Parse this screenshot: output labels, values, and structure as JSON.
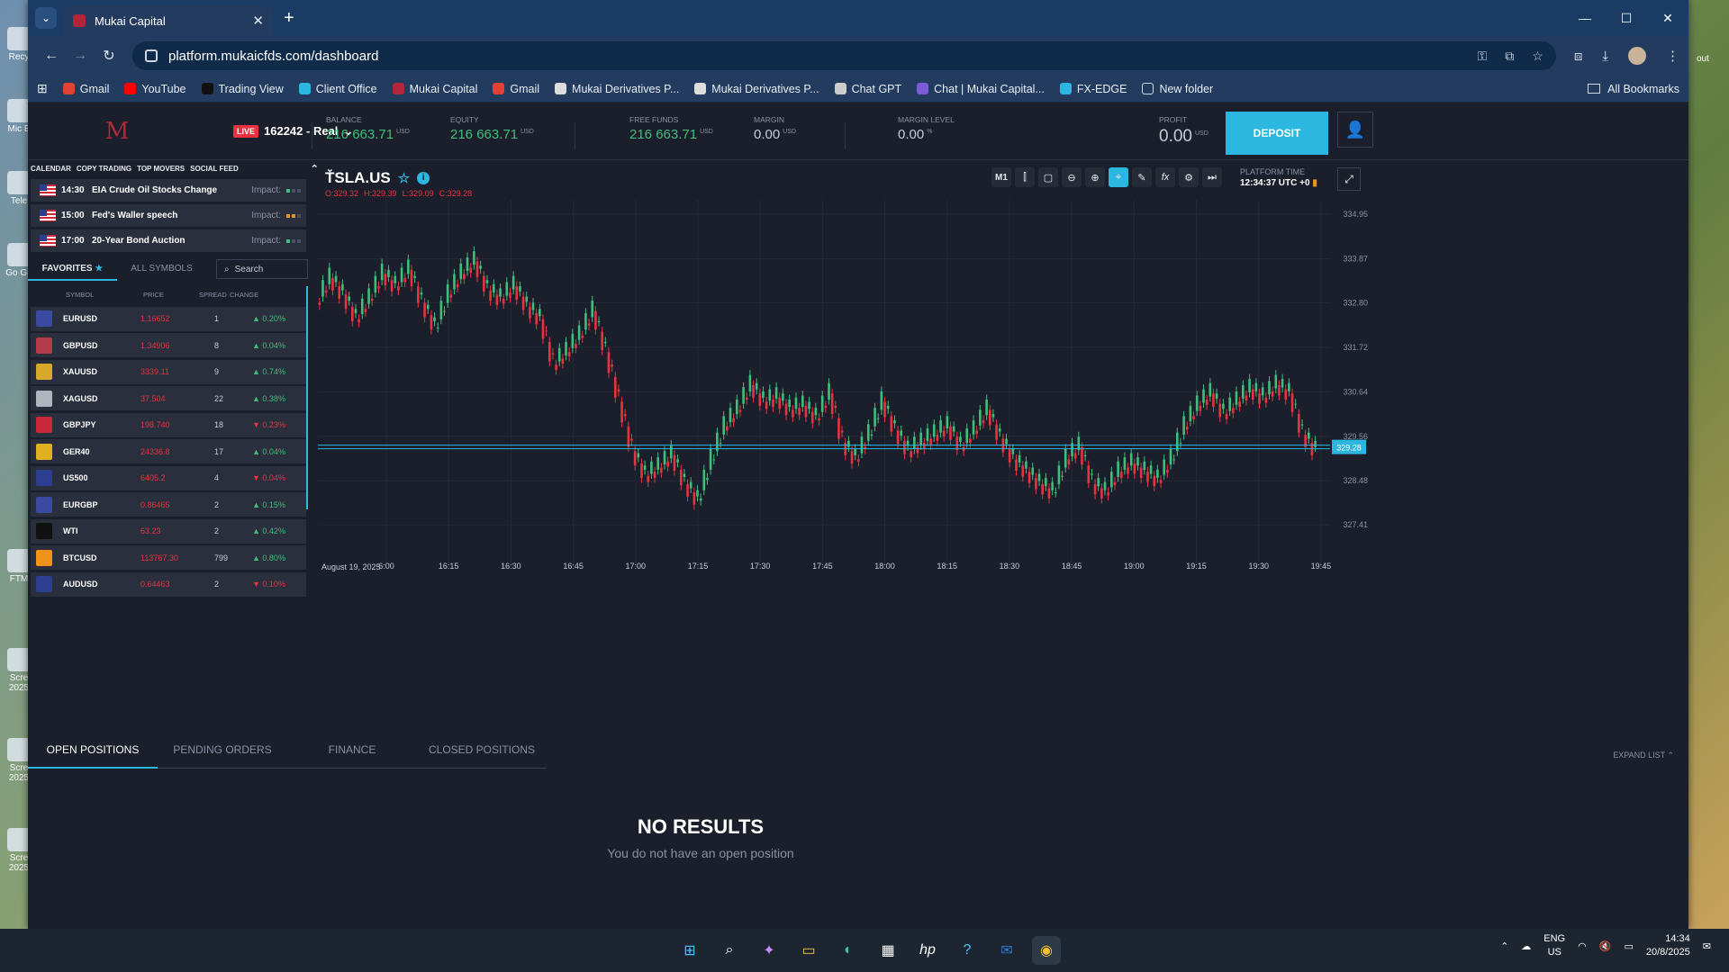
{
  "desktop": {
    "icon_labels": [
      "Recy",
      "Mic E",
      "Tele",
      "Go Gh",
      "FTM",
      "Scre 2025",
      "Scre 2025",
      "Scre 2025"
    ],
    "right_labels": [
      "out"
    ]
  },
  "browser": {
    "tab_title": "Mukai Capital",
    "url": "platform.mukaicfds.com/dashboard",
    "bookmarks": [
      "Gmail",
      "YouTube",
      "Trading View",
      "Client Office",
      "Mukai Capital",
      "Gmail",
      "Mukai  Derivatives P...",
      "Mukai Derivatives P...",
      "Chat GPT",
      "Chat | Mukai Capital...",
      "FX-EDGE",
      "New folder"
    ],
    "all_bookmarks": "All Bookmarks"
  },
  "topbar": {
    "live_badge": "LIVE",
    "account": "162242 - Real",
    "balance": {
      "label": "BALANCE",
      "value": "216 663.71",
      "unit": "USD"
    },
    "equity": {
      "label": "EQUITY",
      "value": "216 663.71",
      "unit": "USD"
    },
    "free_funds": {
      "label": "FREE FUNDS",
      "value": "216 663.71",
      "unit": "USD"
    },
    "margin": {
      "label": "MARGIN",
      "value": "0.00",
      "unit": "USD"
    },
    "margin_level": {
      "label": "MARGIN LEVEL",
      "value": "0.00",
      "unit": "%"
    },
    "profit": {
      "label": "PROFIT",
      "value": "0.00",
      "unit": "USD"
    },
    "deposit": "DEPOSIT"
  },
  "feed": {
    "tabs": [
      "CALENDAR",
      "COPY TRADING",
      "TOP MOVERS",
      "SOCIAL FEED"
    ],
    "events": [
      {
        "time": "14:30",
        "name": "EIA Crude Oil Stocks Change",
        "impact": "Impact:",
        "level": 1
      },
      {
        "time": "15:00",
        "name": "Fed's Waller speech",
        "impact": "Impact:",
        "level": 2
      },
      {
        "time": "17:00",
        "name": "20-Year Bond Auction",
        "impact": "Impact:",
        "level": 1
      }
    ]
  },
  "symbols": {
    "tabs": [
      "FAVORITES",
      "ALL SYMBOLS"
    ],
    "search_placeholder": "Search",
    "columns": [
      "SYMBOL",
      "PRICE",
      "SPREAD",
      "CHANGE"
    ],
    "rows": [
      {
        "symbol": "EURUSD",
        "price": "1.16652",
        "spread": "1",
        "change": "0.20%",
        "dir": "up",
        "icon": "#3a4aa0"
      },
      {
        "symbol": "GBPUSD",
        "price": "1.34906",
        "spread": "8",
        "change": "0.04%",
        "dir": "up",
        "icon": "#b33a4a"
      },
      {
        "symbol": "XAUUSD",
        "price": "3339.11",
        "spread": "9",
        "change": "0.74%",
        "dir": "up",
        "icon": "#d8a82a"
      },
      {
        "symbol": "XAGUSD",
        "price": "37.504",
        "spread": "22",
        "change": "0.38%",
        "dir": "up",
        "icon": "#b0b4bc"
      },
      {
        "symbol": "GBPJPY",
        "price": "198.740",
        "spread": "18",
        "change": "0.23%",
        "dir": "down",
        "icon": "#c8283a"
      },
      {
        "symbol": "GER40",
        "price": "24336.8",
        "spread": "17",
        "change": "0.04%",
        "dir": "up",
        "icon": "#e0b020"
      },
      {
        "symbol": "US500",
        "price": "6405.2",
        "spread": "4",
        "change": "0.04%",
        "dir": "down",
        "icon": "#2c3e8f"
      },
      {
        "symbol": "EURGBP",
        "price": "0.86465",
        "spread": "2",
        "change": "0.15%",
        "dir": "up",
        "icon": "#3a4aa0"
      },
      {
        "symbol": "WTI",
        "price": "63.23",
        "spread": "2",
        "change": "0.42%",
        "dir": "up",
        "icon": "#111111"
      },
      {
        "symbol": "BTCUSD",
        "price": "113767.30",
        "spread": "799",
        "change": "0.80%",
        "dir": "up",
        "icon": "#f0931a"
      },
      {
        "symbol": "AUDUSD",
        "price": "0.64463",
        "spread": "2",
        "change": "0.10%",
        "dir": "down",
        "icon": "#2c3e8f"
      }
    ]
  },
  "chart": {
    "symbol": "TSLA.US",
    "ohlc": {
      "o": "O:329.32",
      "h": "H:329.39",
      "l": "L:329.09",
      "c": "C:329.28"
    },
    "tools": [
      "M1",
      "candles",
      "rect",
      "zoom-out",
      "zoom-in",
      "crosshair",
      "pen",
      "fx",
      "gear",
      "play"
    ],
    "platform_time_label": "PLATFORM TIME",
    "platform_time": "12:34:37 UTC +0",
    "current_price_label": "329.28",
    "date_label": "August 19, 2025"
  },
  "chart_data": {
    "type": "line",
    "title": "",
    "x_ticks": [
      "6:00",
      "16:15",
      "16:30",
      "16:45",
      "17:00",
      "17:15",
      "17:30",
      "17:45",
      "18:00",
      "18:15",
      "18:30",
      "18:45",
      "19:00",
      "19:15",
      "19:30",
      "19:45"
    ],
    "y_ticks": [
      334.95,
      333.87,
      332.8,
      331.72,
      330.64,
      329.56,
      328.48,
      327.41
    ],
    "ylim": [
      327.0,
      335.3
    ],
    "current_price": 329.28,
    "series": [
      {
        "values": [
          332.8,
          333.4,
          333.0,
          332.4,
          332.9,
          333.5,
          333.2,
          333.6,
          332.8,
          332.2,
          333.0,
          333.5,
          333.8,
          333.1,
          332.9,
          333.2,
          332.7,
          332.4,
          331.3,
          331.6,
          332.0,
          332.6,
          331.6,
          330.4,
          329.2,
          328.6,
          328.8,
          329.1,
          328.4,
          328.0,
          329.0,
          329.8,
          330.2,
          330.8,
          330.4,
          330.5,
          330.2,
          330.3,
          330.0,
          330.6,
          329.4,
          329.0,
          329.6,
          330.4,
          329.7,
          329.2,
          329.4,
          329.6,
          329.8,
          329.3,
          329.7,
          330.2,
          329.5,
          329.0,
          328.7,
          328.4,
          328.2,
          329.0,
          329.3,
          328.4,
          328.2,
          328.7,
          328.9,
          328.7,
          328.5,
          329.0,
          329.8,
          330.3,
          330.6,
          330.1,
          330.4,
          330.7,
          330.5,
          330.8,
          330.6,
          329.6,
          329.2
        ]
      }
    ]
  },
  "bottom": {
    "tabs": [
      "OPEN POSITIONS",
      "PENDING ORDERS",
      "FINANCE",
      "CLOSED POSITIONS"
    ],
    "expand": "EXPAND LIST",
    "no_results": "NO RESULTS",
    "no_results_sub": "You do not have an open position"
  },
  "taskbar": {
    "lang": "ENG",
    "region": "US",
    "time": "14:34",
    "date": "20/8/2025"
  }
}
